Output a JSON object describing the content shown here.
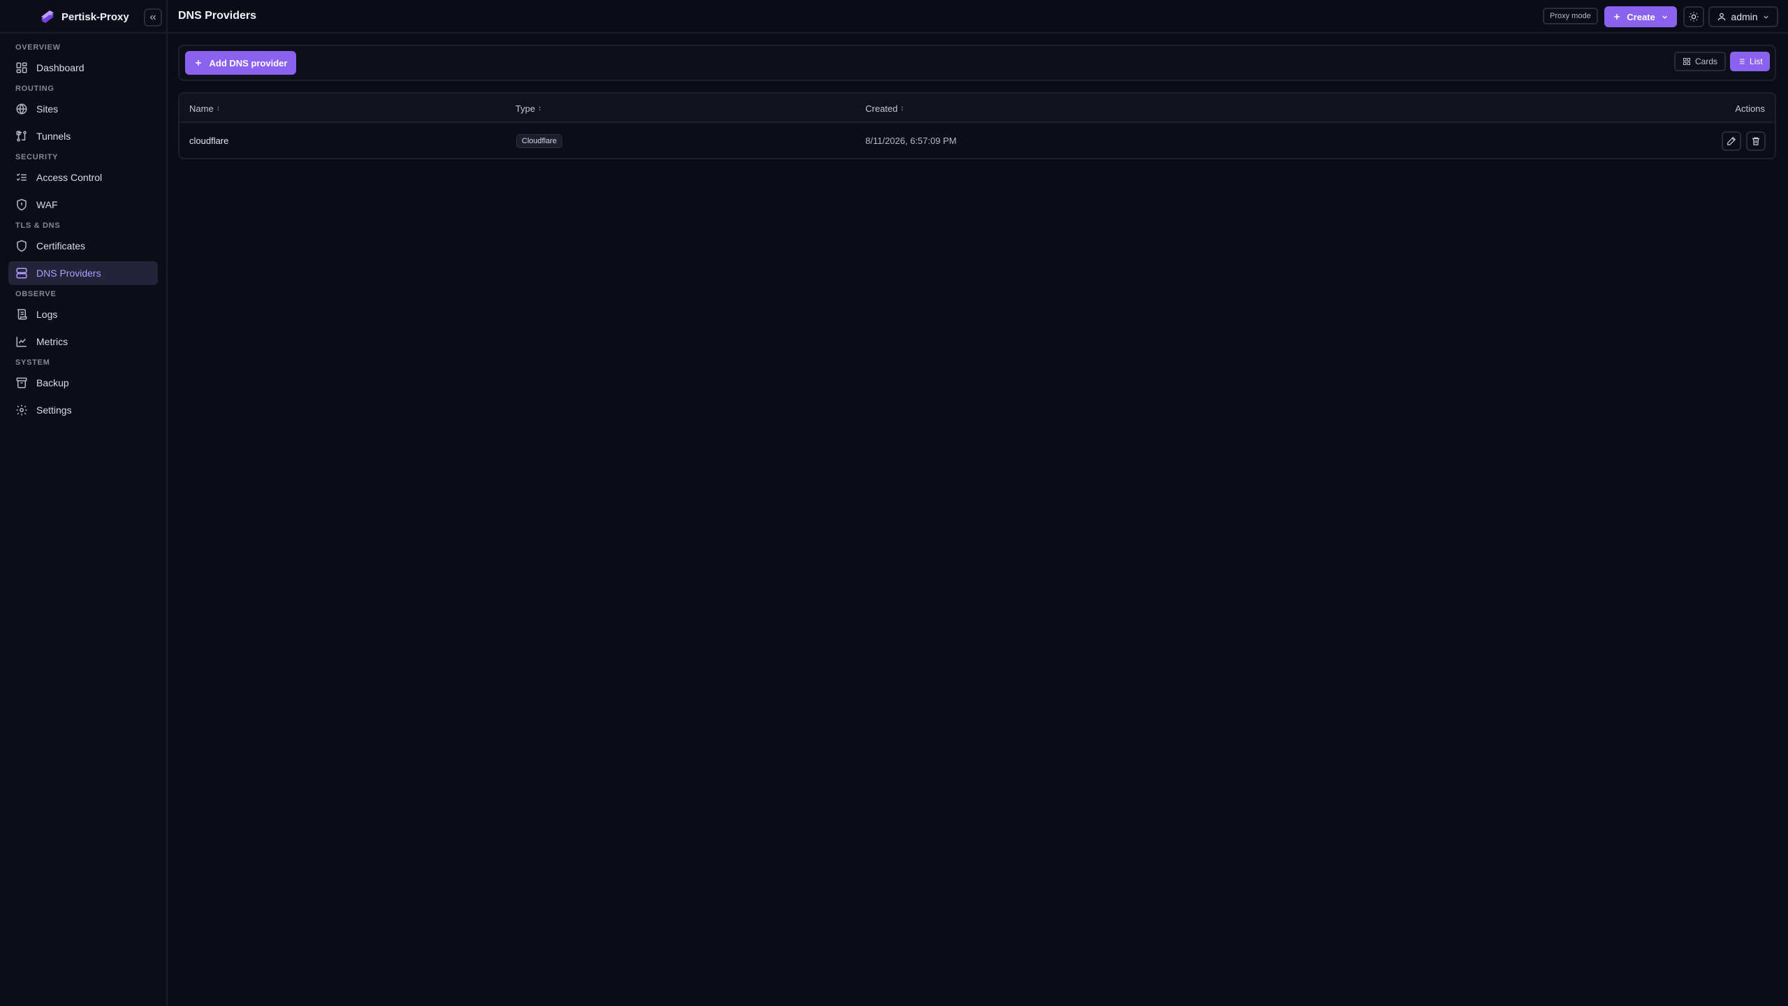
{
  "app": {
    "name": "Pertisk-Proxy"
  },
  "sidebar": {
    "sections": [
      {
        "label": "OVERVIEW",
        "items": [
          {
            "label": "Dashboard",
            "icon": "dashboard-icon"
          }
        ]
      },
      {
        "label": "ROUTING",
        "items": [
          {
            "label": "Sites",
            "icon": "globe-icon"
          },
          {
            "label": "Tunnels",
            "icon": "tunnel-icon"
          }
        ]
      },
      {
        "label": "SECURITY",
        "items": [
          {
            "label": "Access Control",
            "icon": "list-checks-icon"
          },
          {
            "label": "WAF",
            "icon": "shield-icon"
          }
        ]
      },
      {
        "label": "TLS & DNS",
        "items": [
          {
            "label": "Certificates",
            "icon": "shield-outline-icon"
          },
          {
            "label": "DNS Providers",
            "icon": "server-icon",
            "active": true
          }
        ]
      },
      {
        "label": "OBSERVE",
        "items": [
          {
            "label": "Logs",
            "icon": "scroll-icon"
          },
          {
            "label": "Metrics",
            "icon": "line-chart-icon"
          }
        ]
      },
      {
        "label": "SYSTEM",
        "items": [
          {
            "label": "Backup",
            "icon": "archive-icon"
          },
          {
            "label": "Settings",
            "icon": "gear-icon"
          }
        ]
      }
    ]
  },
  "header": {
    "title": "DNS Providers",
    "proxy_mode": "Proxy mode",
    "create_label": "Create",
    "user_label": "admin"
  },
  "toolbar": {
    "add_label": "Add DNS provider",
    "cards_label": "Cards",
    "list_label": "List",
    "active_view": "List"
  },
  "table": {
    "columns": {
      "name": "Name",
      "type": "Type",
      "created": "Created",
      "actions": "Actions"
    },
    "rows": [
      {
        "name": "cloudflare",
        "type": "Cloudflare",
        "created": "8/11/2026, 6:57:09 PM"
      }
    ]
  },
  "colors": {
    "accent": "#8b62f0",
    "active_nav_text": "#b29cff",
    "background": "#0c0c16"
  }
}
